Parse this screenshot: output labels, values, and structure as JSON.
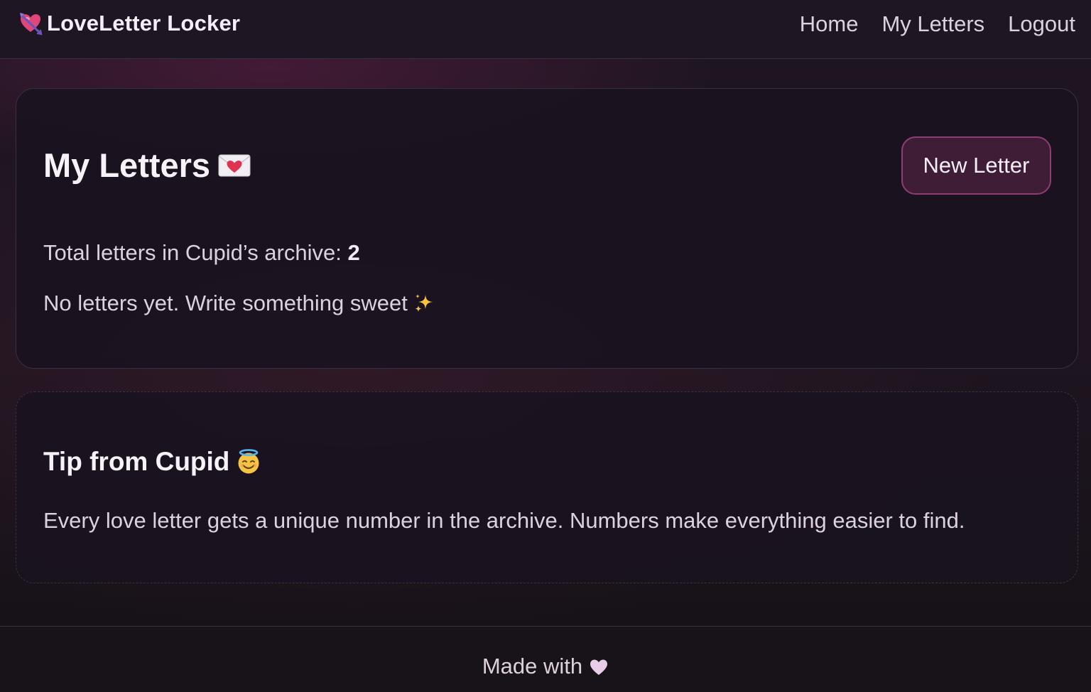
{
  "header": {
    "brand_icon": "heart-with-arrow-icon",
    "brand_name": "LoveLetter Locker",
    "nav": [
      {
        "label": "Home"
      },
      {
        "label": "My Letters"
      },
      {
        "label": "Logout"
      }
    ]
  },
  "letters": {
    "title": "My Letters",
    "title_icon": "love-letter-envelope-icon",
    "new_letter_label": "New Letter",
    "total_prefix": "Total letters in Cupid’s archive: ",
    "total_count": "2",
    "empty_message": "No letters yet. Write something sweet",
    "empty_icon": "sparkles-icon"
  },
  "tip": {
    "title": "Tip from Cupid",
    "title_icon": "smiling-face-with-halo-icon",
    "body": "Every love letter gets a unique number in the archive. Numbers make everything easier to find."
  },
  "footer": {
    "text": "Made with",
    "icon": "heart-icon"
  },
  "colors": {
    "accent": "#8b3f72",
    "button_bg": "#3f1d36",
    "page_bg": "#1e1520",
    "card_bg": "#1a131f",
    "heart_light": "#e8cde8"
  }
}
